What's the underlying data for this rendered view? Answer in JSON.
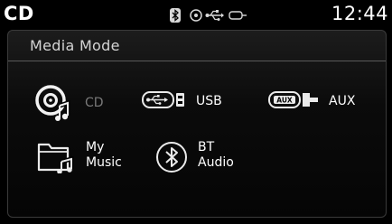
{
  "status_bar": {
    "source": "CD",
    "time": "12:44",
    "icons": [
      "bluetooth-icon",
      "disc-icon",
      "usb-icon",
      "aux-icon"
    ]
  },
  "panel": {
    "title": "Media Mode",
    "items": [
      {
        "label": "CD",
        "icon": "cd-icon",
        "active": true
      },
      {
        "label": "USB",
        "icon": "usb-icon"
      },
      {
        "label": "AUX",
        "icon": "aux-icon"
      },
      {
        "label": "My\nMusic",
        "icon": "my-music-icon"
      },
      {
        "label": "BT\nAudio",
        "icon": "bluetooth-icon"
      }
    ]
  },
  "colors": {
    "background": "#000000",
    "text": "#ffffff",
    "inactive_text": "#7a7a7a",
    "divider": "#5a5a5a"
  }
}
